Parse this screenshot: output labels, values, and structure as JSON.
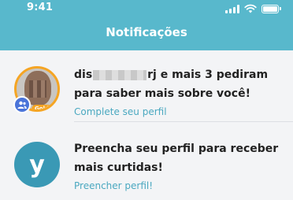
{
  "status_bar": {
    "time": "9:41",
    "icons": [
      "signal-icon",
      "wifi-icon",
      "battery-icon"
    ]
  },
  "header": {
    "title": "Notificações",
    "color": "#58b8cc"
  },
  "notifications": [
    {
      "avatar": "user-photo",
      "badge_label": "Gold",
      "badge_icon": "people-icon",
      "message_start": "dis",
      "message_end": "rj e mais 3 pediram\npara saber mais sobre você!",
      "action": "Complete seu perfil"
    },
    {
      "avatar_letter": "y",
      "message": "Preencha seu perfil para receber\nmais curtidas!",
      "action": "Preencher perfil!"
    }
  ],
  "colors": {
    "accent": "#4aa8c0",
    "gold": "#f5a524",
    "badge_blue": "#4a74d9",
    "brand_avatar": "#3a99b5"
  }
}
